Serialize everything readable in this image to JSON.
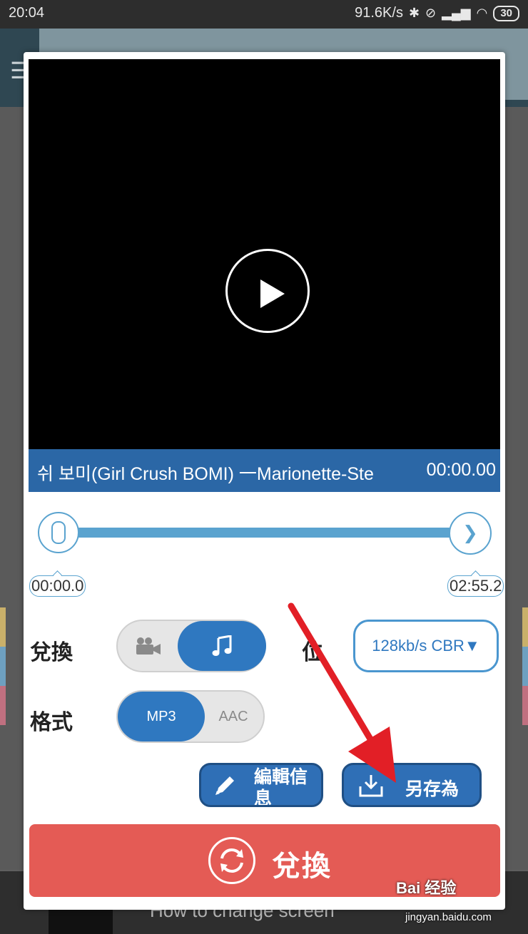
{
  "status_bar": {
    "time": "20:04",
    "speed": "91.6K/s",
    "battery": "30"
  },
  "background": {
    "article_title": "How to change screen"
  },
  "dialog": {
    "title_text": "쉬 보미(Girl Crush BOMI) 一Marionette-Ste",
    "title_time": "00:00.00",
    "range_start": "00:00.0",
    "range_end": "02:55.2",
    "convert_label": "兌換",
    "format_label": "格式",
    "bitrate_label_partial": "位",
    "bitrate_value": "128kb/s CBR▼",
    "format_mp3": "MP3",
    "format_aac": "AAC",
    "edit_info_label": "編輯信息",
    "save_as_label": "另存為",
    "convert_button_label": "兌換"
  },
  "watermark": {
    "text": "Bai 经验",
    "sub": "jingyan.baidu.com"
  },
  "colors": {
    "accent": "#2f78c0",
    "convert": "#e45b55",
    "arrow": "#e21f26"
  }
}
